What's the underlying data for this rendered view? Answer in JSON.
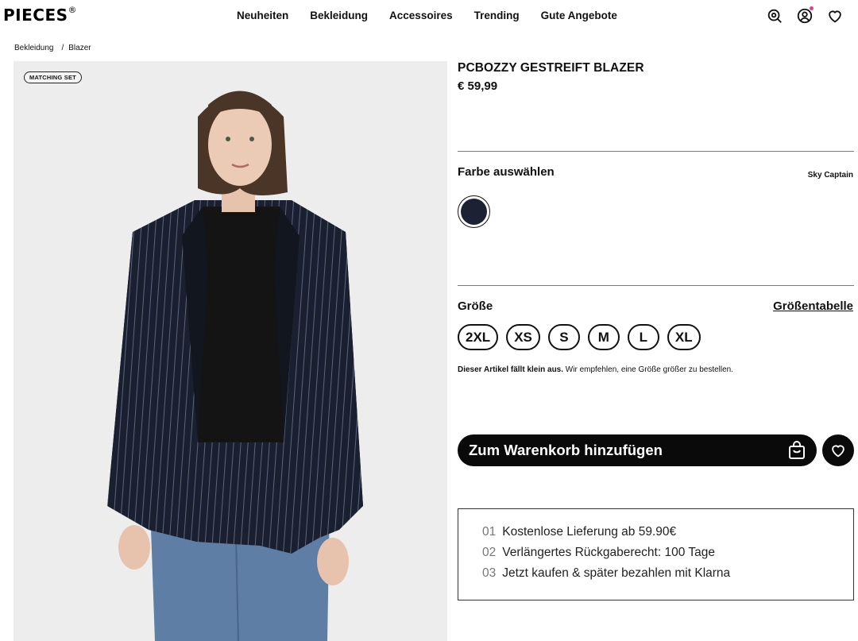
{
  "header": {
    "logo": "PIECES",
    "logo_mark": "®",
    "nav": [
      "Neuheiten",
      "Bekleidung",
      "Accessoires",
      "Trending",
      "Gute Angebote"
    ],
    "icons": [
      "search-icon",
      "account-icon",
      "wishlist-heart-icon"
    ]
  },
  "breadcrumb": {
    "items": [
      "Bekleidung",
      "Blazer"
    ],
    "separator": "/"
  },
  "image": {
    "badge": "MATCHING SET"
  },
  "product": {
    "title": "PCBOZZY GESTREIFT BLAZER",
    "price": "€ 59,99"
  },
  "color": {
    "label": "Farbe auswählen",
    "selected": "Sky Captain",
    "swatch_hex": "#1c2233"
  },
  "size": {
    "label": "Größe",
    "chart_link": "Größentabelle",
    "options": [
      "2XL",
      "XS",
      "S",
      "M",
      "L",
      "XL"
    ],
    "note_bold": "Dieser Artikel fällt klein aus.",
    "note_rest": " Wir empfehlen, eine Größe größer zu bestellen."
  },
  "cart": {
    "label": "Zum Warenkorb hinzufügen"
  },
  "usps": [
    {
      "num": "01",
      "text": "Kostenlose Lieferung ab 59.90€"
    },
    {
      "num": "02",
      "text": "Verlängertes Rückgaberecht: 100 Tage"
    },
    {
      "num": "03",
      "text": "Jetzt kaufen & später bezahlen mit Klarna"
    }
  ]
}
